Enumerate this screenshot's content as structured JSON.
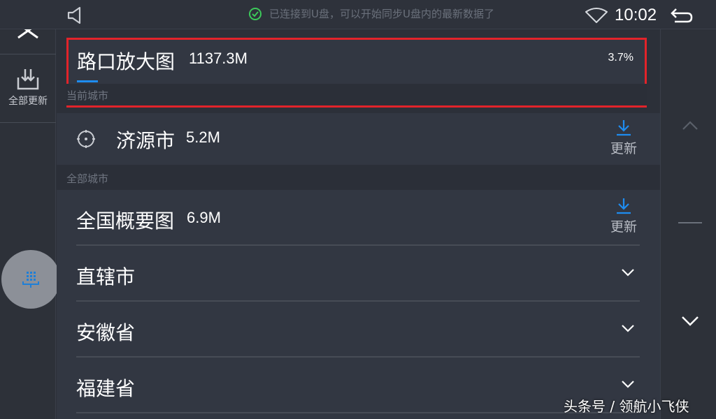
{
  "status_bar": {
    "notice": "已连接到U盘，可以开始同步U盘内的最新数据了",
    "time": "10:02"
  },
  "sidebar": {
    "update_all_label": "全部更新"
  },
  "downloading": {
    "name": "路口放大图",
    "size": "1137.3M",
    "percent": "3.7%",
    "progress": 0.037
  },
  "sections": {
    "current_city": "当前城市",
    "all_cities": "全部城市"
  },
  "current_city": {
    "name": "济源市",
    "size": "5.2M",
    "action": "更新"
  },
  "all_cities": [
    {
      "name": "全国概要图",
      "size": "6.9M",
      "action": "更新"
    },
    {
      "name": "直辖市"
    },
    {
      "name": "安徽省"
    },
    {
      "name": "福建省"
    }
  ],
  "watermark": "头条号 / 领航小飞侠",
  "colors": {
    "accent": "#1e8cf0",
    "highlight_border": "#e2232a",
    "background": "#2c3039"
  },
  "icons": {
    "home": "home-icon",
    "speaker": "speaker-icon",
    "check": "check-circle-icon",
    "wifi": "wifi-icon",
    "back": "back-arrow-icon",
    "update_all": "download-box-icon",
    "mic": "keypad-icon",
    "location": "location-icon",
    "download": "download-icon",
    "expand": "chevron-down-icon"
  }
}
